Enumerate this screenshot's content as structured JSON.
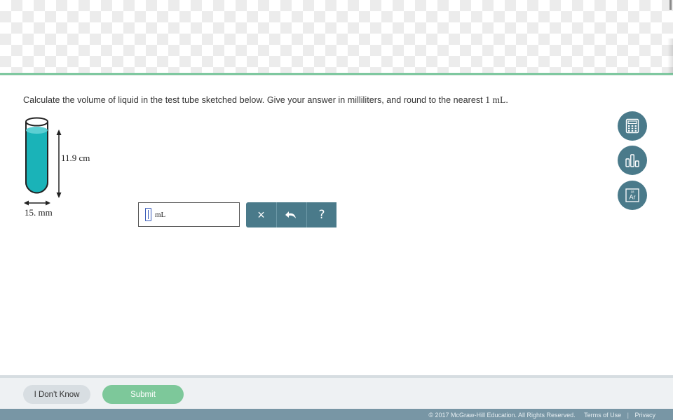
{
  "question": {
    "text_before": "Calculate the volume of liquid in the test tube sketched below. Give your answer in milliliters, and round to the nearest ",
    "round_value": "1 mL",
    "text_after": "."
  },
  "diagram": {
    "height_label": "11.9 cm",
    "width_label": "15. mm",
    "liquid_color": "#1ab3b8"
  },
  "answer": {
    "value": "",
    "unit": "mL"
  },
  "tools": {
    "clear_symbol": "×",
    "undo_symbol": "↶",
    "help_symbol": "?"
  },
  "side_tools": {
    "calculator_icon": "calculator-icon",
    "data_icon": "bar-chart-icon",
    "periodic_icon": "periodic-table-icon",
    "periodic_number": "18",
    "periodic_symbol": "Ar"
  },
  "buttons": {
    "dont_know": "I Don't Know",
    "submit": "Submit"
  },
  "footer": {
    "copyright": "© 2017 McGraw-Hill Education. All Rights Reserved.",
    "terms": "Terms of Use",
    "separator": "|",
    "privacy": "Privacy"
  },
  "colors": {
    "accent": "#4a7a8a",
    "submit": "#7dc89a",
    "rule": "#7fc8a0"
  }
}
